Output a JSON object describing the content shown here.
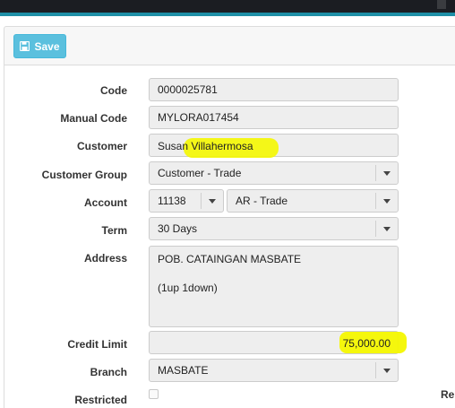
{
  "toolbar": {
    "save_label": "Save"
  },
  "form": {
    "code_label": "Code",
    "code_value": "0000025781",
    "manual_code_label": "Manual Code",
    "manual_code_value": "MYLORA017454",
    "customer_label": "Customer",
    "customer_value": "Susan Villahermosa",
    "customer_group_label": "Customer Group",
    "customer_group_value": "Customer - Trade",
    "account_label": "Account",
    "account_code_value": "11138",
    "account_name_value": "AR - Trade",
    "term_label": "Term",
    "term_value": "30 Days",
    "address_label": "Address",
    "address_line1": "POB. CATAINGAN MASBATE",
    "address_line2": "(1up 1down)",
    "credit_limit_label": "Credit Limit",
    "credit_limit_value": "75,000.00",
    "branch_label": "Branch",
    "branch_value": "MASBATE",
    "restricted_label": "Restricted",
    "restricted_checked": false,
    "right_cut_label": "Re"
  },
  "colors": {
    "accent": "#1e8fa6",
    "save_button": "#5bc0de",
    "highlight": "#f4f700"
  },
  "icons": {
    "save": "floppy-disk-icon",
    "dropdown": "caret-down-icon"
  }
}
